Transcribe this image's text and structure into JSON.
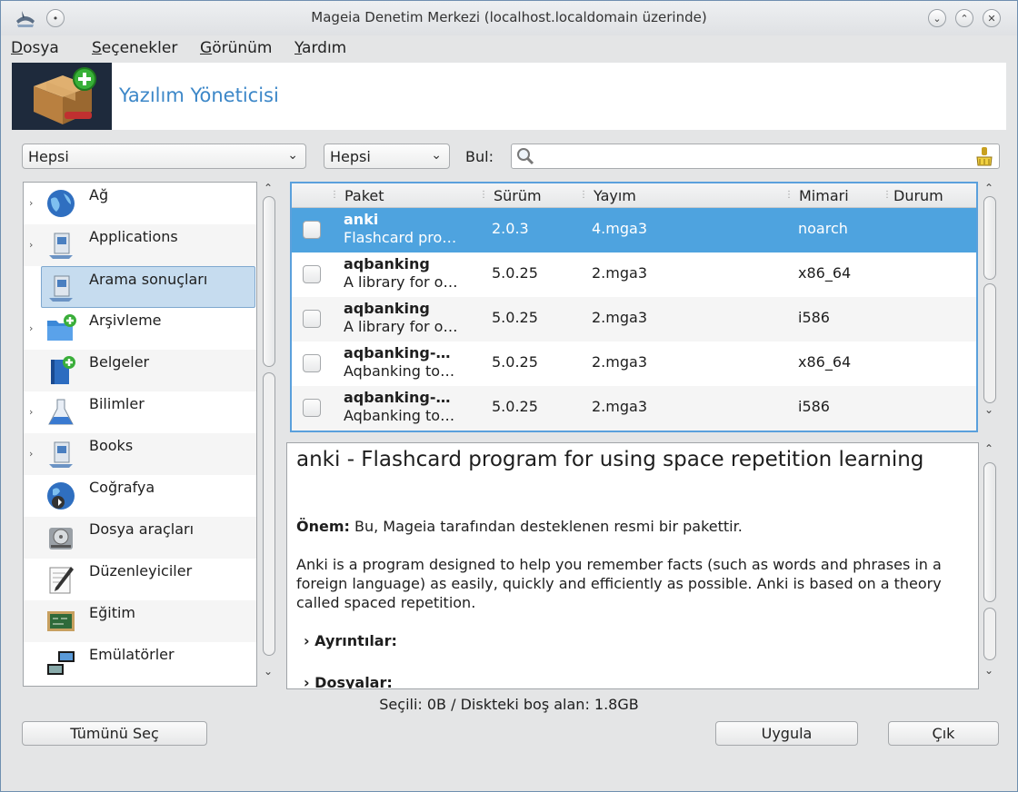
{
  "window": {
    "title": "Mageia Denetim Merkezi  (localhost.localdomain üzerinde)"
  },
  "menu": {
    "items": [
      {
        "mnemonic": "D",
        "rest": "osya"
      },
      {
        "mnemonic": "S",
        "rest": "eçenekler"
      },
      {
        "mnemonic": "G",
        "rest": "örünüm"
      },
      {
        "mnemonic": "Y",
        "rest": "ardım"
      }
    ]
  },
  "banner": {
    "title": "Yazılım Yöneticisi"
  },
  "filters": {
    "group_value": "Hepsi",
    "type_value": "Hepsi",
    "find_label": "Bul:",
    "search_value": ""
  },
  "categories": [
    {
      "label": "Ağ",
      "icon": "globe-icon"
    },
    {
      "label": "Applications",
      "icon": "applications-icon"
    },
    {
      "label": "Arama sonuçları",
      "icon": "search-results-icon"
    },
    {
      "label": "Arşivleme",
      "icon": "archive-folder-icon"
    },
    {
      "label": "Belgeler",
      "icon": "document-book-icon"
    },
    {
      "label": "Bilimler",
      "icon": "flask-icon"
    },
    {
      "label": "Books",
      "icon": "books-icon"
    },
    {
      "label": "Coğrafya",
      "icon": "geography-globe-icon"
    },
    {
      "label": "Dosya araçları",
      "icon": "disk-icon"
    },
    {
      "label": "Düzenleyiciler",
      "icon": "editor-pencil-icon"
    },
    {
      "label": "Eğitim",
      "icon": "chalkboard-icon"
    },
    {
      "label": "Emülatörler",
      "icon": "emulator-icon"
    }
  ],
  "packages": {
    "columns": [
      "Paket",
      "Sürüm",
      "Yayım",
      "Mimari",
      "Durum"
    ],
    "rows": [
      {
        "name": "anki",
        "desc": "Flashcard pro…",
        "version": "2.0.3",
        "release": "4.mga3",
        "arch": "noarch"
      },
      {
        "name": "aqbanking",
        "desc": "A library for o…",
        "version": "5.0.25",
        "release": "2.mga3",
        "arch": "x86_64"
      },
      {
        "name": "aqbanking",
        "desc": "A library for o…",
        "version": "5.0.25",
        "release": "2.mga3",
        "arch": "i586"
      },
      {
        "name": "aqbanking-…",
        "desc": "Aqbanking to…",
        "version": "5.0.25",
        "release": "2.mga3",
        "arch": "x86_64"
      },
      {
        "name": "aqbanking-…",
        "desc": "Aqbanking to…",
        "version": "5.0.25",
        "release": "2.mga3",
        "arch": "i586"
      }
    ]
  },
  "description": {
    "title": "anki - Flashcard program for using space repetition learning",
    "importance_label": "Önem:",
    "importance_text": " Bu, Mageia tarafından desteklenen resmi bir pakettir.",
    "body": "Anki is a program designed to help you remember facts (such as words and phrases in a foreign language) as easily, quickly and efficiently as possible. Anki is based on a theory called spaced repetition.",
    "details_label": "Ayrıntılar:",
    "files_label": "Dosyalar:"
  },
  "status": {
    "text": "Seçili: 0B / Diskteki boş alan: 1.8GB"
  },
  "buttons": {
    "select_all": "Tümünü Seç",
    "apply": "Uygula",
    "quit": "Çık"
  }
}
